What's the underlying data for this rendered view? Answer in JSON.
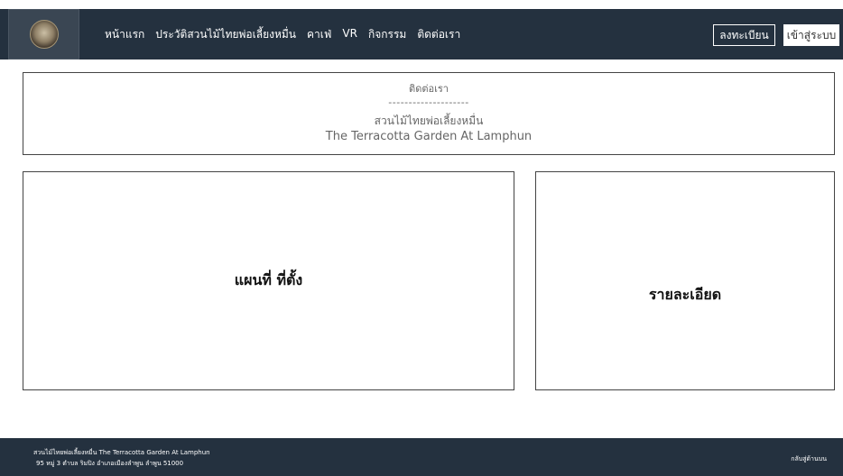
{
  "colors": {
    "navbar_bg": "#24313f",
    "footer_bg": "#24313f",
    "border": "#444444"
  },
  "header": {
    "logo": "logo-seal",
    "nav": [
      {
        "label": "หน้าแรก"
      },
      {
        "label": "ประวัติสวนไม้ไทยพ่อเลี้ยงหมื่น"
      },
      {
        "label": "คาเฟ่"
      },
      {
        "label": "VR"
      },
      {
        "label": "กิจกรรม"
      },
      {
        "label": "ติดต่อเรา"
      }
    ],
    "register_label": "ลงทะเบียน",
    "login_label": "เข้าสู่ระบบ"
  },
  "contact": {
    "title": "ติดต่อเรา",
    "divider": "--------------------",
    "name_th": "สวนไม้ไทยพ่อเลี้ยงหมื่น",
    "name_en": "The Terracotta Garden At Lamphun"
  },
  "main": {
    "map_label": "แผนที่ ที่ตั้ง",
    "detail_label": "รายละเอียด"
  },
  "footer": {
    "line1": "สวนไม้ไทยพ่อเลี้ยงหมื่น The Terracotta Garden At Lamphun",
    "line2": "95 หมู่ 3 ตำบล ริมปิง อำเภอเมืองลำพูน ลำพูน 51000",
    "back_label": "กลับสู่ด้านบน"
  }
}
